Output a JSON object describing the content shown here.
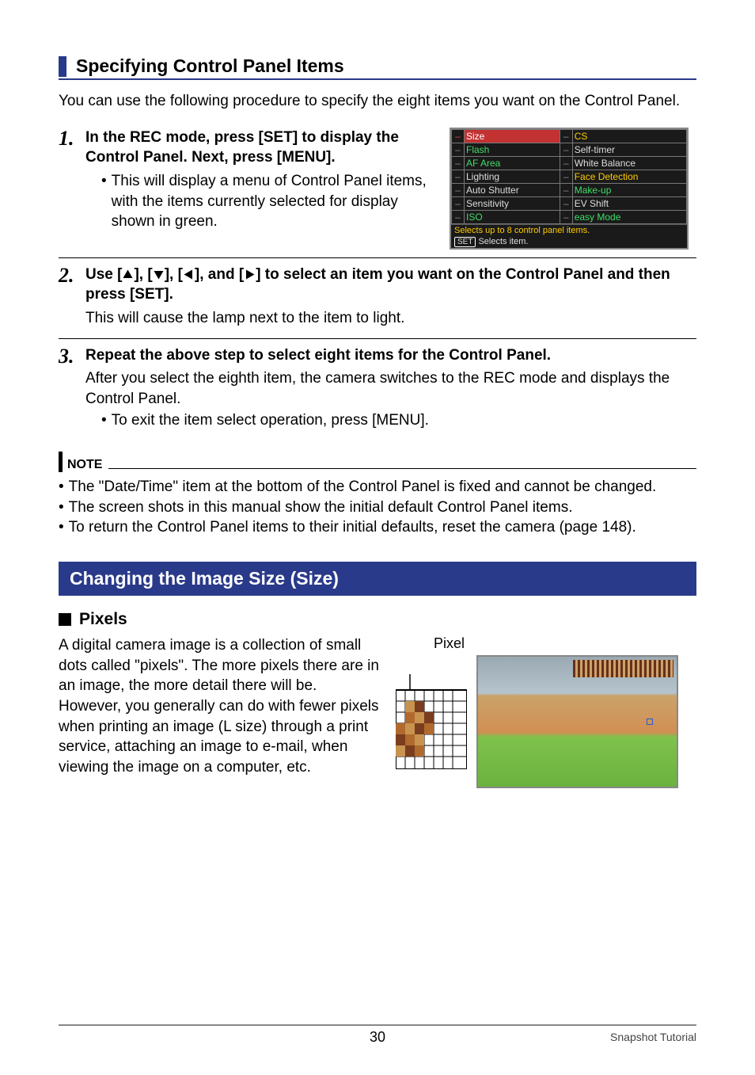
{
  "section": {
    "title": "Specifying Control Panel Items"
  },
  "intro": "You can use the following procedure to specify the eight items you want on the Control Panel.",
  "steps": {
    "s1": {
      "num": "1.",
      "head": "In the REC mode, press [SET] to display the Control Panel. Next, press [MENU].",
      "bullet": "This will display a menu of Control Panel items, with the items currently selected for display shown in green."
    },
    "s2": {
      "num": "2.",
      "head_pre": "Use [",
      "head_mid1": "], [",
      "head_mid2": "], [",
      "head_mid3": "], and [",
      "head_post": "] to select an item you want on the Control Panel and then press [SET].",
      "sub": "This will cause the lamp next to the item to light."
    },
    "s3": {
      "num": "3.",
      "head": "Repeat the above step to select eight items for the Control Panel.",
      "sub": "After you select the eighth item, the camera switches to the REC mode and displays the Control Panel.",
      "bullet": "To exit the item select operation, press [MENU]."
    }
  },
  "screenshot": {
    "left": [
      "Size",
      "Flash",
      "AF Area",
      "Lighting",
      "Auto Shutter",
      "Sensitivity",
      "ISO"
    ],
    "right": [
      "CS",
      "Self-timer",
      "White Balance",
      "Face Detection",
      "Make-up",
      "EV Shift",
      "easy Mode"
    ],
    "msg1": "Selects up to 8 control panel items.",
    "msg2_btn": "SET",
    "msg2_text": "Selects item."
  },
  "note": {
    "label": "NOTE",
    "items": [
      "The \"Date/Time\" item at the bottom of the Control Panel is fixed and cannot be changed.",
      "The screen shots in this manual show the initial default Control Panel items.",
      "To return the Control Panel items to their initial defaults, reset the camera (page 148)."
    ]
  },
  "bluebar": "Changing the Image Size (Size)",
  "pixels": {
    "head": "Pixels",
    "text": "A digital camera image is a collection of small dots called \"pixels\". The more pixels there are in an image, the more detail there will be. However, you generally can do with fewer pixels when printing an image (L size) through a print service, attaching an image to e-mail, when viewing the image on a computer, etc.",
    "label": "Pixel"
  },
  "footer": {
    "page": "30",
    "right": "Snapshot Tutorial"
  }
}
